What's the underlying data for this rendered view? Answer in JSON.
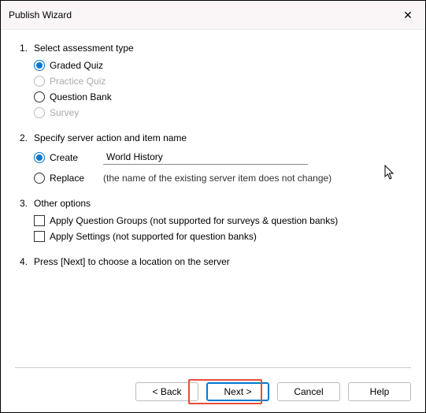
{
  "window": {
    "title": "Publish Wizard",
    "close_label": "✕"
  },
  "steps": {
    "s1": {
      "num": "1.",
      "title": "Select assessment type",
      "options": {
        "graded": "Graded Quiz",
        "practice": "Practice Quiz",
        "qbank": "Question Bank",
        "survey": "Survey"
      }
    },
    "s2": {
      "num": "2.",
      "title": "Specify server action and item name",
      "create_label": "Create",
      "item_name": "World History",
      "replace_label": "Replace",
      "replace_note": "(the name of the existing server item does not change)"
    },
    "s3": {
      "num": "3.",
      "title": "Other options",
      "opt_groups": "Apply Question Groups (not supported for surveys & question banks)",
      "opt_settings": "Apply Settings (not supported for question banks)"
    },
    "s4": {
      "num": "4.",
      "title": "Press [Next] to choose a location on the server"
    }
  },
  "buttons": {
    "back": "< Back",
    "next": "Next >",
    "cancel": "Cancel",
    "help": "Help"
  }
}
